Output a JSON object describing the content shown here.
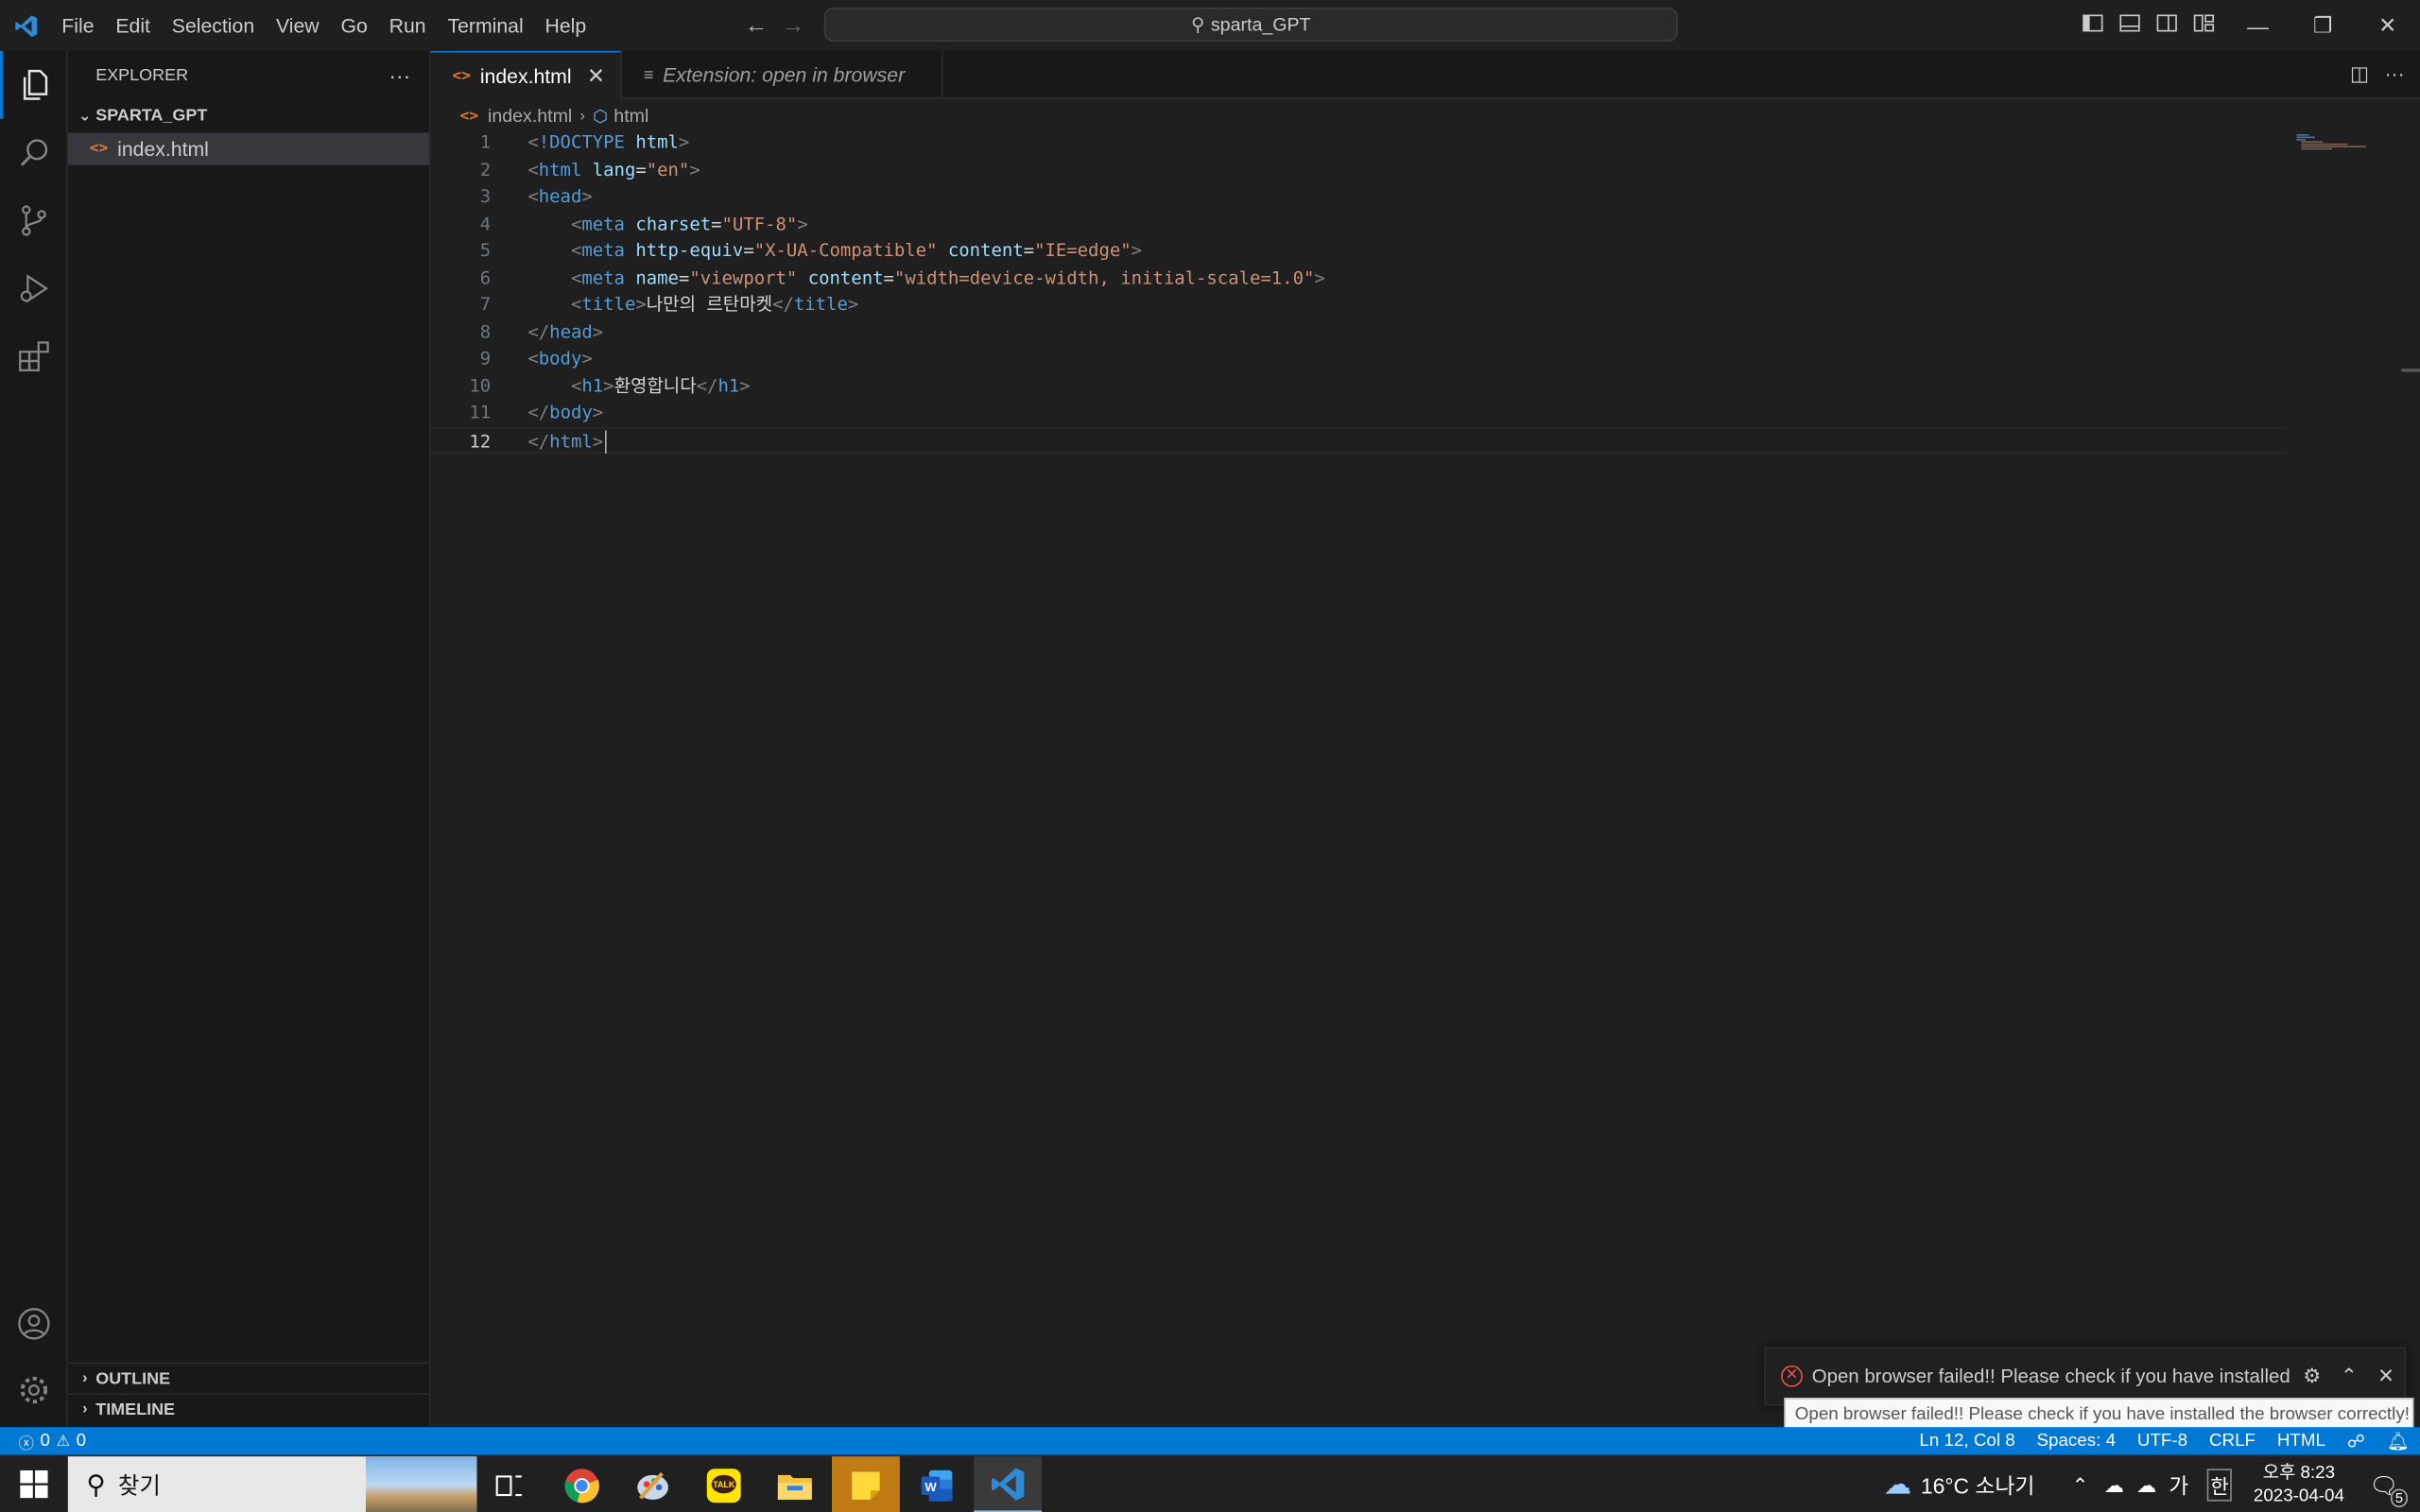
{
  "titlebar": {
    "menu": [
      "File",
      "Edit",
      "Selection",
      "View",
      "Go",
      "Run",
      "Terminal",
      "Help"
    ],
    "search_text": "sparta_GPT"
  },
  "sidebar": {
    "title": "EXPLORER",
    "more": "···",
    "folder": "SPARTA_GPT",
    "files": [
      "index.html"
    ],
    "outline": "OUTLINE",
    "timeline": "TIMELINE"
  },
  "tabs": [
    {
      "label": "index.html",
      "active": true
    },
    {
      "label": "Extension: open in browser",
      "active": false
    }
  ],
  "breadcrumb": {
    "file": "index.html",
    "symbol": "html"
  },
  "editor": {
    "lines": [
      {
        "n": "1",
        "html": "<span class='t'>&lt;</span><span class='tg'>!DOCTYPE</span> <span class='at'>html</span><span class='t'>&gt;</span>"
      },
      {
        "n": "2",
        "html": "<span class='t'>&lt;</span><span class='tg'>html</span> <span class='at'>lang</span><span class='tx'>=</span><span class='st'>\"en\"</span><span class='t'>&gt;</span>"
      },
      {
        "n": "3",
        "html": "<span class='t'>&lt;</span><span class='tg'>head</span><span class='t'>&gt;</span>"
      },
      {
        "n": "4",
        "html": "    <span class='t'>&lt;</span><span class='tg'>meta</span> <span class='at'>charset</span><span class='tx'>=</span><span class='st'>\"UTF-8\"</span><span class='t'>&gt;</span>"
      },
      {
        "n": "5",
        "html": "    <span class='t'>&lt;</span><span class='tg'>meta</span> <span class='at'>http-equiv</span><span class='tx'>=</span><span class='st'>\"X-UA-Compatible\"</span> <span class='at'>content</span><span class='tx'>=</span><span class='st'>\"IE=edge\"</span><span class='t'>&gt;</span>"
      },
      {
        "n": "6",
        "html": "    <span class='t'>&lt;</span><span class='tg'>meta</span> <span class='at'>name</span><span class='tx'>=</span><span class='st'>\"viewport\"</span> <span class='at'>content</span><span class='tx'>=</span><span class='st'>\"width=device-width, initial-scale=1.0\"</span><span class='t'>&gt;</span>"
      },
      {
        "n": "7",
        "html": "    <span class='t'>&lt;</span><span class='tg'>title</span><span class='t'>&gt;</span><span class='tx'>나만의 르탄마켓</span><span class='t'>&lt;/</span><span class='tg'>title</span><span class='t'>&gt;</span>"
      },
      {
        "n": "8",
        "html": "<span class='t'>&lt;/</span><span class='tg'>head</span><span class='t'>&gt;</span>"
      },
      {
        "n": "9",
        "html": "<span class='t'>&lt;</span><span class='tg'>body</span><span class='t'>&gt;</span>"
      },
      {
        "n": "10",
        "html": "    <span class='t'>&lt;</span><span class='tg'>h1</span><span class='t'>&gt;</span><span class='tx'>환영합니다</span><span class='t'>&lt;/</span><span class='tg'>h1</span><span class='t'>&gt;</span>"
      },
      {
        "n": "11",
        "html": "<span class='t'>&lt;/</span><span class='tg'>body</span><span class='t'>&gt;</span>"
      },
      {
        "n": "12",
        "html": "<span class='t'>&lt;/</span><span class='tg'>html</span><span class='t'>&gt;</span><span class='cursor'></span>"
      }
    ]
  },
  "notification": {
    "message": "Open browser failed!! Please check if you have installed ...",
    "tooltip": "Open browser failed!! Please check if you have installed the browser  correctly!"
  },
  "statusbar": {
    "errors": "0",
    "warnings": "0",
    "position": "Ln 12, Col 8",
    "spaces": "Spaces: 4",
    "encoding": "UTF-8",
    "eol": "CRLF",
    "language": "HTML"
  },
  "taskbar": {
    "search_placeholder": "찾기",
    "weather": "16°C  소나기",
    "ime_mode": "가",
    "ime_lang": "한",
    "time": "오후 8:23",
    "date": "2023-04-04",
    "notifications": "5"
  },
  "colors": {
    "accent": "#0078d4",
    "status_bar": "#0078d4",
    "error": "#f14c4c",
    "html_icon": "#e37933"
  }
}
